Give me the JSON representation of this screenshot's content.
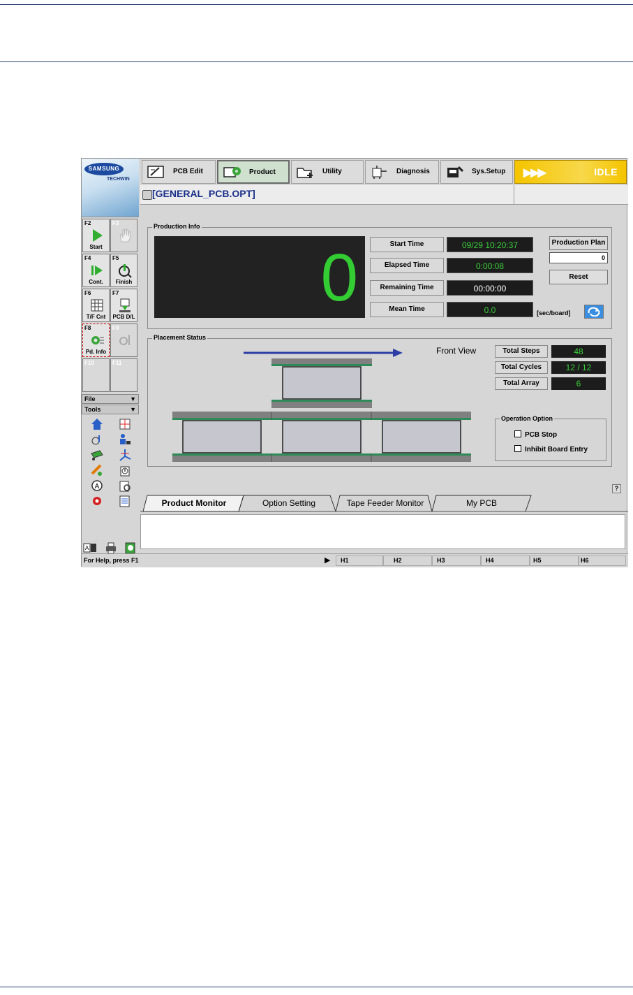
{
  "left_panel": {
    "brand": "SAMSUNG",
    "brand_sub": "TECHWIN",
    "fkeys": [
      {
        "key": "F2",
        "label": "Start"
      },
      {
        "key": "F3",
        "label": ""
      },
      {
        "key": "F4",
        "label": "Cont."
      },
      {
        "key": "F5",
        "label": "Finish"
      },
      {
        "key": "F6",
        "label": "T/F Cnt"
      },
      {
        "key": "F7",
        "label": "PCB D/L"
      },
      {
        "key": "F8",
        "label": "Pd. Info"
      },
      {
        "key": "F9",
        "label": ""
      },
      {
        "key": "F10",
        "label": ""
      },
      {
        "key": "F11",
        "label": ""
      }
    ],
    "file_menu": "File",
    "tools_menu": "Tools"
  },
  "nav": {
    "tabs": [
      {
        "label": "PCB Edit",
        "icon": "pcb-edit-icon"
      },
      {
        "label": "Product",
        "icon": "product-gear-icon"
      },
      {
        "label": "Utility",
        "icon": "utility-folder-icon"
      },
      {
        "label": "Diagnosis",
        "icon": "diagnosis-icon"
      },
      {
        "label": "Sys.Setup",
        "icon": "sys-setup-icon"
      }
    ],
    "status": "IDLE",
    "status_arrows": "▶▶▶"
  },
  "file_name": "[GENERAL_PCB.OPT]",
  "production_info": {
    "title": "Production Info",
    "counter": "0",
    "rows": [
      {
        "label": "Start Time",
        "value": "09/29 10:20:37"
      },
      {
        "label": "Elapsed Time",
        "value": "0:00:08"
      },
      {
        "label": "Remaining Time",
        "value": "00:00:00"
      },
      {
        "label": "Mean Time",
        "value": "0.0"
      }
    ],
    "unit": "[sec/board]",
    "plan_label": "Production Plan",
    "plan_value": "0",
    "reset_label": "Reset"
  },
  "placement_status": {
    "title": "Placement Status",
    "view_label": "Front View",
    "stats": [
      {
        "label": "Total Steps",
        "value": "48"
      },
      {
        "label": "Total Cycles",
        "value": "12 / 12"
      },
      {
        "label": "Total Array",
        "value": "6"
      }
    ],
    "operation_option": {
      "title": "Operation Option",
      "options": [
        "PCB Stop",
        "Inhibit Board Entry"
      ]
    }
  },
  "help_glyph": "?",
  "bottom_tabs": [
    "Product Monitor",
    "Option Setting",
    "Tape Feeder Monitor",
    "My PCB"
  ],
  "statusbar": {
    "help": "For Help, press F1",
    "play": "▶",
    "cells": [
      "H1",
      "H2",
      "H3",
      "H4",
      "H5",
      "H6"
    ]
  },
  "colors": {
    "accent_green": "#3ad03a",
    "idle_yellow": "#f5c400",
    "file_blue": "#1a2f8a",
    "rail_green": "#2e8b57"
  }
}
